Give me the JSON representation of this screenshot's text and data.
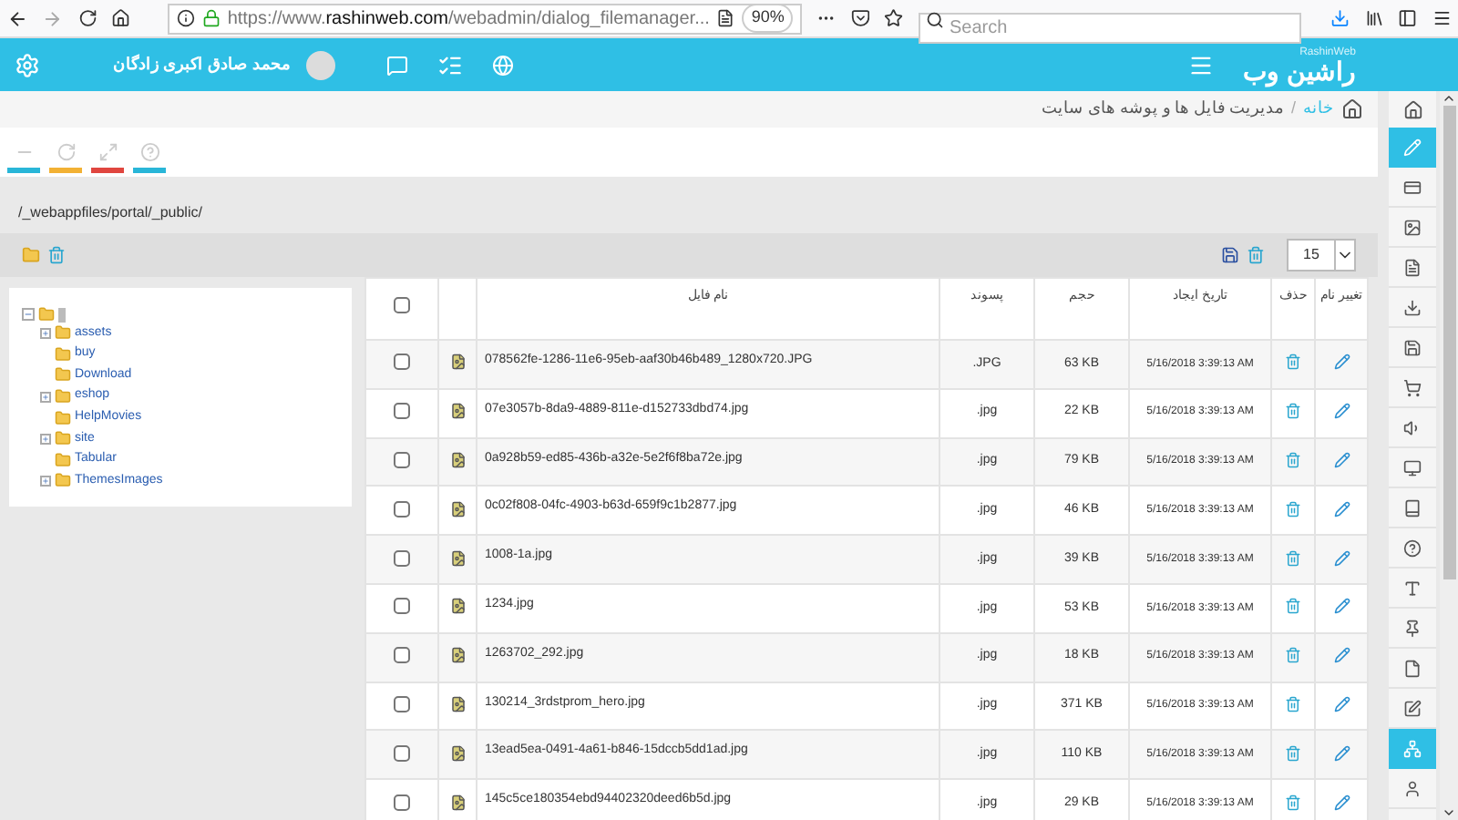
{
  "browser": {
    "url_host": "https://www.",
    "url_domain": "rashinweb.com",
    "url_path": "/webadmin/dialog_filemanager...",
    "zoom": "90%",
    "search": {
      "placeholder": "Search"
    }
  },
  "header": {
    "logo": "راشین وب",
    "logo_sub": "RashinWeb",
    "user_name": "محمد صادق اکبری زادگان"
  },
  "breadcrumb": {
    "separator": "/",
    "items": [
      "خانه",
      "مدیریت فایل ها و پوشه های سایت"
    ]
  },
  "toolbar_tabs": [
    {
      "color": "#29b6d8"
    },
    {
      "color": "#f2b134"
    },
    {
      "color": "#e0463f"
    },
    {
      "color": "#29b6d8"
    }
  ],
  "path": "/_webappfiles/portal/_public/",
  "page_size": "15",
  "tree": {
    "expanded": true,
    "children": [
      {
        "label": "assets",
        "expandable": true
      },
      {
        "label": "buy",
        "expandable": false
      },
      {
        "label": "Download",
        "expandable": false
      },
      {
        "label": "eshop",
        "expandable": true
      },
      {
        "label": "HelpMovies",
        "expandable": false
      },
      {
        "label": "site",
        "expandable": true
      },
      {
        "label": "Tabular",
        "expandable": false
      },
      {
        "label": "ThemesImages",
        "expandable": true
      }
    ]
  },
  "table": {
    "select_all": {
      "checked": false
    },
    "columns": [
      "تغییر نام",
      "حذف",
      "تاریخ ایجاد",
      "حجم",
      "پسوند",
      "نام فایل"
    ],
    "rows": [
      {
        "checked": false,
        "name": "078562fe-1286-11e6-95eb-aaf30b46b489_1280x720.JPG",
        "ext": ".JPG",
        "size": "63 KB",
        "date": "5/16/2018 3:39:13 AM"
      },
      {
        "checked": false,
        "name": "07e3057b-8da9-4889-811e-d152733dbd74.jpg",
        "ext": ".jpg",
        "size": "22 KB",
        "date": "5/16/2018 3:39:13 AM"
      },
      {
        "checked": false,
        "name": "0a928b59-ed85-436b-a32e-5e2f6f8ba72e.jpg",
        "ext": ".jpg",
        "size": "79 KB",
        "date": "5/16/2018 3:39:13 AM"
      },
      {
        "checked": false,
        "name": "0c02f808-04fc-4903-b63d-659f9c1b2877.jpg",
        "ext": ".jpg",
        "size": "46 KB",
        "date": "5/16/2018 3:39:13 AM"
      },
      {
        "checked": false,
        "name": "1008-1a.jpg",
        "ext": ".jpg",
        "size": "39 KB",
        "date": "5/16/2018 3:39:13 AM"
      },
      {
        "checked": false,
        "name": "1234.jpg",
        "ext": ".jpg",
        "size": "53 KB",
        "date": "5/16/2018 3:39:13 AM"
      },
      {
        "checked": false,
        "name": "1263702_292.jpg",
        "ext": ".jpg",
        "size": "18 KB",
        "date": "5/16/2018 3:39:13 AM"
      },
      {
        "checked": false,
        "name": "130214_3rdstprom_hero.jpg",
        "ext": ".jpg",
        "size": "371 KB",
        "date": "5/16/2018 3:39:13 AM"
      },
      {
        "checked": false,
        "name": "13ead5ea-0491-4a61-b846-15dccb5dd1ad.jpg",
        "ext": ".jpg",
        "size": "110 KB",
        "date": "5/16/2018 3:39:13 AM"
      },
      {
        "checked": false,
        "name": "145c5ce180354ebd94402320deed6b5d.jpg",
        "ext": ".jpg",
        "size": "29 KB",
        "date": "5/16/2018 3:39:13 AM"
      }
    ]
  },
  "sidebar": {
    "items": [
      {
        "selected": true
      },
      {
        "selected": false
      },
      {
        "selected": false
      },
      {
        "selected": false
      },
      {
        "selected": false
      },
      {
        "selected": false
      },
      {
        "selected": false
      },
      {
        "selected": false
      },
      {
        "selected": false
      },
      {
        "selected": false
      },
      {
        "selected": false
      },
      {
        "selected": false
      },
      {
        "selected": false
      },
      {
        "selected": false
      },
      {
        "selected": false
      },
      {
        "selected": true
      },
      {
        "selected": false
      }
    ]
  }
}
